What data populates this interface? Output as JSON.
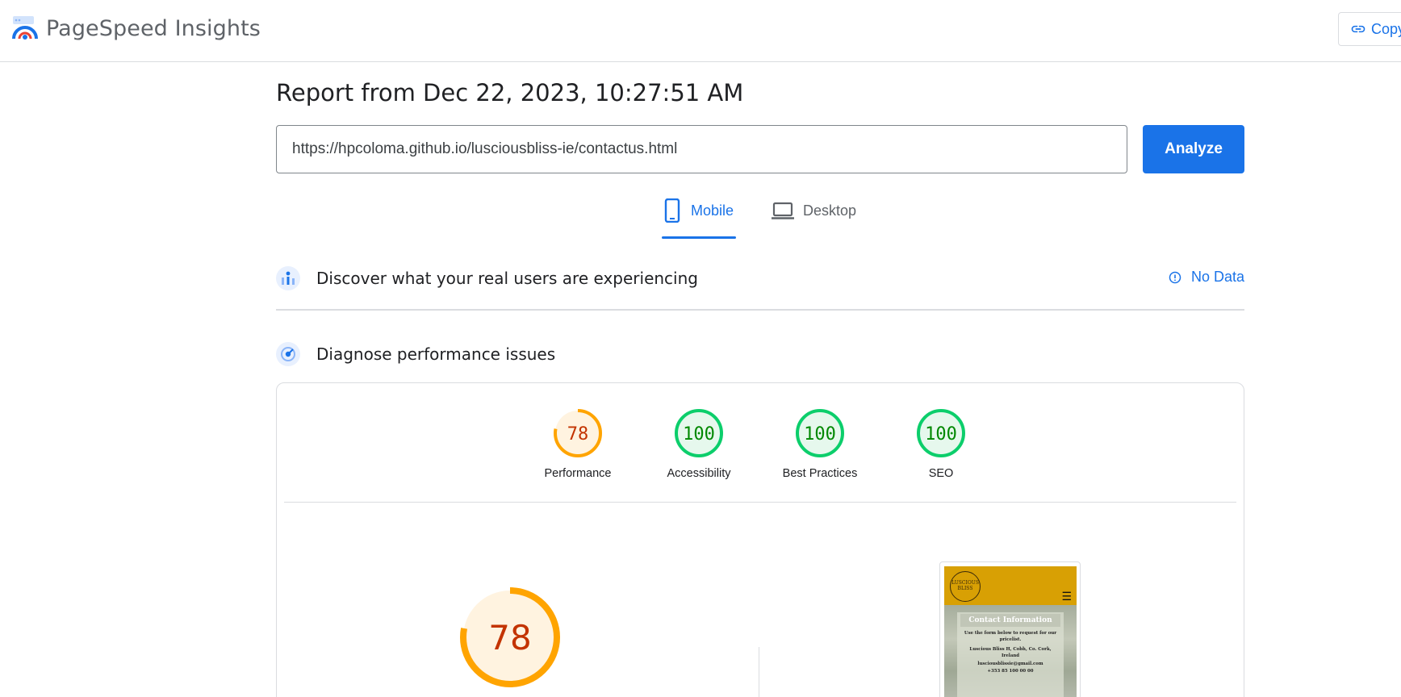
{
  "header": {
    "app_name": "PageSpeed Insights",
    "copy_label": "Copy link"
  },
  "report": {
    "title": "Report from Dec 22, 2023, 10:27:51 AM",
    "url_value": "https://hpcoloma.github.io/lusciousbliss-ie/contactus.html",
    "analyze_label": "Analyze"
  },
  "tabs": [
    {
      "label": "Mobile",
      "icon": "smartphone-icon",
      "selected": true
    },
    {
      "label": "Desktop",
      "icon": "laptop-icon",
      "selected": false
    }
  ],
  "sections": {
    "real_users": {
      "title": "Discover what your real users are experiencing",
      "status": "No Data"
    },
    "diagnose": {
      "title": "Diagnose performance issues"
    }
  },
  "scores": [
    {
      "label": "Performance",
      "value": "78",
      "status": "average"
    },
    {
      "label": "Accessibility",
      "value": "100",
      "status": "pass"
    },
    {
      "label": "Best Practices",
      "value": "100",
      "status": "pass"
    },
    {
      "label": "SEO",
      "value": "100",
      "status": "pass"
    }
  ],
  "main_score": {
    "value": "78"
  },
  "colors": {
    "accent": "#1a73e8",
    "average_stroke": "#ffa400",
    "average_text": "#c33300",
    "average_fill": "#fff3e0",
    "pass_stroke": "#0cce6b",
    "pass_text": "#008800",
    "pass_fill": "#e6f8ed"
  },
  "screenshot": {
    "logo_line1": "LUSCIOUS",
    "logo_line2": "BLISS",
    "heading": "Contact Information",
    "intro": "Use the form below to request for our pricelist.",
    "address": "Luscious Bliss H, Cobh, Co. Cork, Ireland",
    "email": "lusciousblissie@gmail.com",
    "phone": "+353 85 100 00 00"
  }
}
